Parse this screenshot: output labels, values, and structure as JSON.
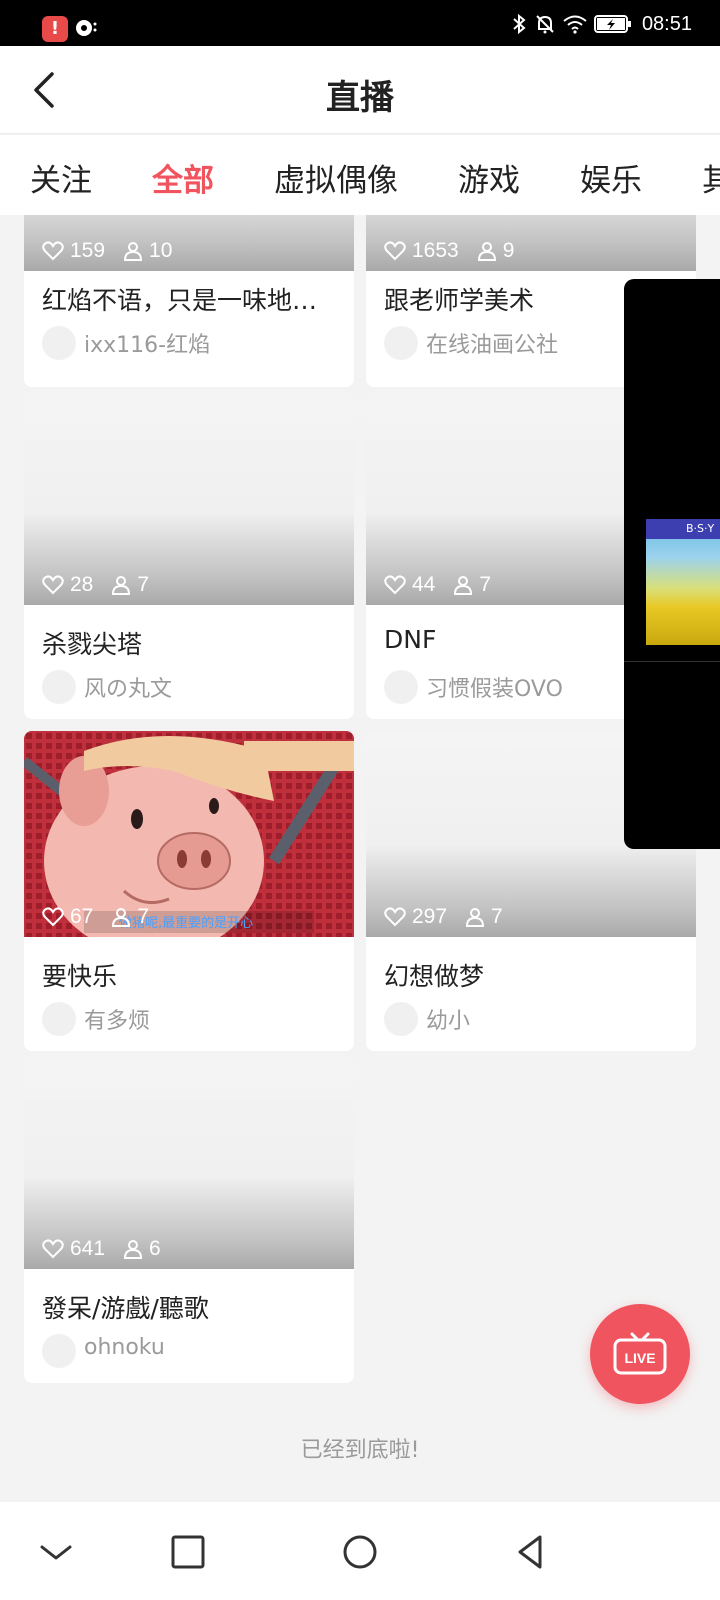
{
  "status_bar": {
    "time": "08:51"
  },
  "header": {
    "title": "直播"
  },
  "tabs": [
    {
      "label": "关注"
    },
    {
      "label": "全部"
    },
    {
      "label": "虚拟偶像"
    },
    {
      "label": "游戏"
    },
    {
      "label": "娱乐"
    },
    {
      "label": "其"
    }
  ],
  "cards": [
    {
      "likes": "159",
      "viewers": "10",
      "title": "红焰不语，只是一味地…",
      "streamer": "ixx116-红焰"
    },
    {
      "likes": "1653",
      "viewers": "9",
      "title": "跟老师学美术",
      "streamer": "在线油画公社"
    },
    {
      "likes": "28",
      "viewers": "7",
      "title": "杀戮尖塔",
      "streamer": "风の丸文"
    },
    {
      "likes": "44",
      "viewers": "7",
      "title": "DNF",
      "streamer": "习惯假装OVO"
    },
    {
      "likes": "67",
      "viewers": "7",
      "title": "要快乐",
      "streamer": "有多烦",
      "subtitle": "做猪呢,最重要的是开心"
    },
    {
      "likes": "297",
      "viewers": "7",
      "title": "幻想做梦",
      "streamer": "幼小"
    },
    {
      "likes": "641",
      "viewers": "6",
      "title": "發呆/游戲/聽歌",
      "streamer": "ohnoku"
    }
  ],
  "floating_video": {
    "label": "B·S·Y"
  },
  "footer": {
    "end_text": "已经到底啦!"
  },
  "live_button": {
    "label": "LIVE"
  },
  "colors": {
    "accent": "#f0545f"
  }
}
